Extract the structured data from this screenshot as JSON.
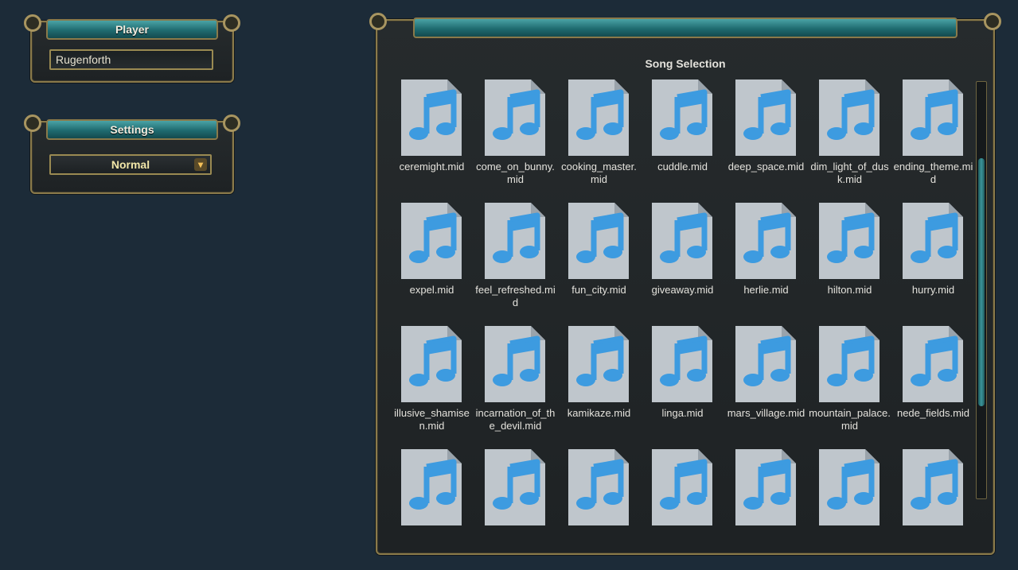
{
  "player": {
    "title": "Player",
    "name_value": "Rugenforth"
  },
  "settings": {
    "title": "Settings",
    "selected": "Normal",
    "chevron": "▾"
  },
  "songs": {
    "title": "Song Selection",
    "icon": "music-file-icon",
    "items": [
      "ceremight.mid",
      "come_on_bunny.mid",
      "cooking_master.mid",
      "cuddle.mid",
      "deep_space.mid",
      "dim_light_of_dusk.mid",
      "ending_theme.mid",
      "expel.mid",
      "feel_refreshed.mid",
      "fun_city.mid",
      "giveaway.mid",
      "herlie.mid",
      "hilton.mid",
      "hurry.mid",
      "illusive_shamisen.mid",
      "incarnation_of_the_devil.mid",
      "kamikaze.mid",
      "linga.mid",
      "mars_village.mid",
      "mountain_palace.mid",
      "nede_fields.mid",
      "",
      "",
      "",
      "",
      "",
      "",
      ""
    ]
  },
  "colors": {
    "background": "#1c2b38",
    "accent_teal": "#1f6b70",
    "gold_trim": "#8a7a4a",
    "file_icon": "#bfc6cc",
    "note": "#3d9be0"
  }
}
